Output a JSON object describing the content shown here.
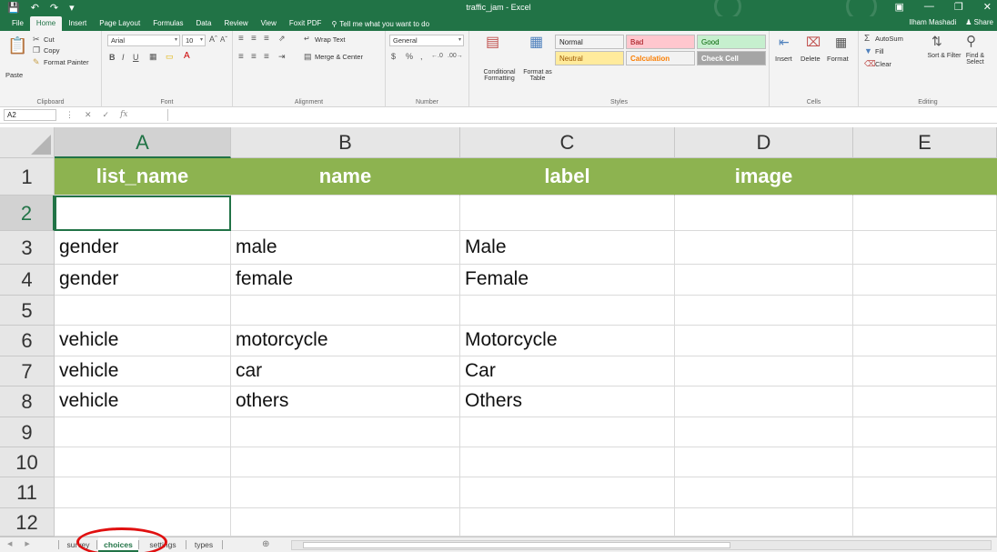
{
  "window": {
    "title": "traffic_jam - Excel"
  },
  "menu": {
    "tabs": [
      "File",
      "Home",
      "Insert",
      "Page Layout",
      "Formulas",
      "Data",
      "Review",
      "View",
      "Foxit PDF"
    ],
    "tell_me": "Tell me what you want to do",
    "user": "Ilham Mashadi",
    "share": "Share"
  },
  "ribbon": {
    "clipboard": {
      "paste": "Paste",
      "cut": "Cut",
      "copy": "Copy",
      "format_painter": "Format Painter",
      "label": "Clipboard"
    },
    "font": {
      "name": "Arial",
      "size": "10",
      "label": "Font"
    },
    "alignment": {
      "wrap_text": "Wrap Text",
      "merge_center": "Merge & Center",
      "label": "Alignment"
    },
    "number": {
      "format": "General",
      "label": "Number"
    },
    "styles": {
      "conditional": "Conditional Formatting",
      "format_as_table": "Format as Table",
      "label": "Styles",
      "cells": [
        {
          "name": "Normal",
          "bg": "#ffffff",
          "fg": "#000000"
        },
        {
          "name": "Bad",
          "bg": "#ffc7ce",
          "fg": "#9c0006"
        },
        {
          "name": "Good",
          "bg": "#c6efce",
          "fg": "#006100"
        },
        {
          "name": "Neutral",
          "bg": "#ffeb9c",
          "fg": "#9c5700"
        },
        {
          "name": "Calculation",
          "bg": "#f2f2f2",
          "fg": "#fa7d00"
        },
        {
          "name": "Check Cell",
          "bg": "#a5a5a5",
          "fg": "#ffffff"
        }
      ]
    },
    "cells": {
      "insert": "Insert",
      "delete": "Delete",
      "format": "Format",
      "label": "Cells"
    },
    "editing": {
      "autosum": "AutoSum",
      "fill": "Fill",
      "clear": "Clear",
      "sort_filter": "Sort & Filter",
      "find_select": "Find & Select",
      "label": "Editing"
    }
  },
  "formula_bar": {
    "name_box": "A2",
    "fx": "fx",
    "value": ""
  },
  "sheet": {
    "columns": [
      "A",
      "B",
      "C",
      "D",
      "E"
    ],
    "rows": [
      [
        "list_name",
        "name",
        "label",
        "image",
        ""
      ],
      [
        "",
        "",
        "",
        "",
        ""
      ],
      [
        "gender",
        "male",
        "Male",
        "",
        ""
      ],
      [
        "gender",
        "female",
        "Female",
        "",
        ""
      ],
      [
        "",
        "",
        "",
        "",
        ""
      ],
      [
        "vehicle",
        "motorcycle",
        "Motorcycle",
        "",
        ""
      ],
      [
        "vehicle",
        "car",
        "Car",
        "",
        ""
      ],
      [
        "vehicle",
        "others",
        "Others",
        "",
        ""
      ],
      [
        "",
        "",
        "",
        "",
        ""
      ],
      [
        "",
        "",
        "",
        "",
        ""
      ],
      [
        "",
        "",
        "",
        "",
        ""
      ],
      [
        "",
        "",
        "",
        "",
        ""
      ]
    ],
    "row_numbers": [
      "1",
      "2",
      "3",
      "4",
      "5",
      "6",
      "7",
      "8",
      "9",
      "10",
      "11",
      "12"
    ],
    "active_cell": "A2",
    "header_color": "#8db350"
  },
  "sheet_tabs": {
    "tabs": [
      "survey",
      "choices",
      "settings",
      "types"
    ],
    "active": "choices"
  }
}
